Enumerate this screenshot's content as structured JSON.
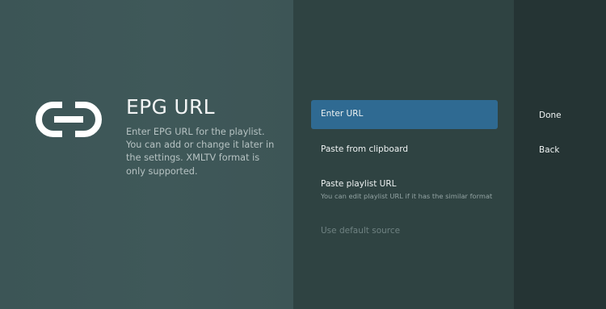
{
  "guidance": {
    "icon": "link-icon",
    "title": "EPG URL",
    "description": "Enter EPG URL for the playlist. You can add or change it later in the settings. XMLTV format is only supported."
  },
  "actions": {
    "enter_url": {
      "label": "Enter URL"
    },
    "paste_clipboard": {
      "label": "Paste from clipboard"
    },
    "paste_playlist": {
      "label": "Paste playlist URL",
      "description": "You can edit playlist URL if it has the similar format"
    },
    "default_source": {
      "label": "Use default source"
    }
  },
  "buttons": {
    "done": "Done",
    "back": "Back"
  },
  "colors": {
    "guidance_bg": "#3f5859",
    "actions_bg": "#2f4342",
    "buttons_bg": "#253434",
    "selected": "#2f6a92"
  }
}
